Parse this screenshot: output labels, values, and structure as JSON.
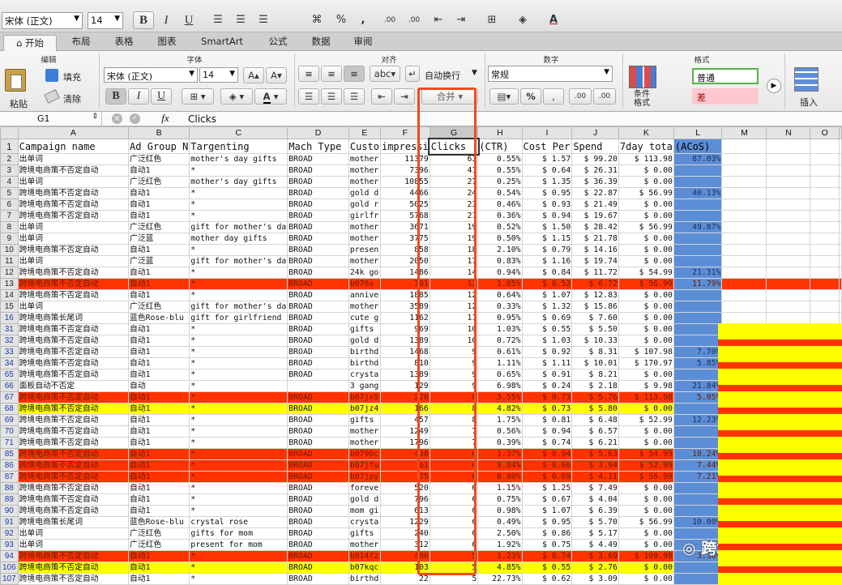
{
  "toolbar": {
    "font": "宋体 (正文)",
    "size": "14",
    "bold": "B",
    "italic": "I",
    "underline": "U",
    "percent": "%",
    "comma": ",",
    "dec_inc": ".00",
    "dec_dec": ".00"
  },
  "tabs": [
    "开始",
    "布局",
    "表格",
    "图表",
    "SmartArt",
    "公式",
    "数据",
    "审阅"
  ],
  "ribbon": {
    "groups": {
      "edit": "编辑",
      "font": "字体",
      "align": "对齐",
      "number": "数字",
      "format": "格式"
    },
    "paste": "粘贴",
    "fill": "填充",
    "clear": "清除",
    "font": "宋体 (正文)",
    "size": "14",
    "wrap": "自动换行",
    "merge": "合并",
    "numfmt": "常规",
    "cond_format": "条件\n格式",
    "style_normal": "普通",
    "style_bad": "差",
    "insert": "插入"
  },
  "formula": {
    "cell": "G1",
    "fx": "fx",
    "value": "Clicks"
  },
  "columns": [
    "A",
    "B",
    "C",
    "D",
    "E",
    "F",
    "G",
    "H",
    "I",
    "J",
    "K",
    "L",
    "M",
    "N",
    "O"
  ],
  "headers": [
    "Campaign name",
    "Ad Group N",
    "Targenting",
    "Mach Type",
    "Custo",
    "impressi",
    "Clicks",
    "(CTR)",
    "Cost Per",
    "Spend",
    "7day tota",
    "(ACoS)"
  ],
  "rows": [
    {
      "r": "2",
      "s": "",
      "c": [
        "出单词",
        "广泛红色",
        "mother's day gifts",
        "BROAD",
        "mother",
        "11379",
        "63",
        "0.55%",
        "$ 1.57",
        "$ 99.20",
        "$ 113.98",
        "87.03%"
      ]
    },
    {
      "r": "3",
      "s": "",
      "c": [
        "跨境电商策不否定自动",
        "自动1",
        "*",
        "BROAD",
        "mother",
        "7396",
        "41",
        "0.55%",
        "$ 0.64",
        "$ 26.31",
        "$ 0.00",
        ""
      ]
    },
    {
      "r": "4",
      "s": "",
      "c": [
        "出单词",
        "广泛红色",
        "mother's day gifts",
        "BROAD",
        "mother",
        "10855",
        "27",
        "0.25%",
        "$ 1.35",
        "$ 36.39",
        "$ 0.00",
        ""
      ]
    },
    {
      "r": "5",
      "s": "",
      "c": [
        "跨境电商策不否定自动",
        "自动1",
        "*",
        "BROAD",
        "gold d",
        "4466",
        "24",
        "0.54%",
        "$ 0.95",
        "$ 22.87",
        "$ 56.99",
        "40.13%"
      ]
    },
    {
      "r": "6",
      "s": "",
      "c": [
        "跨境电商策不否定自动",
        "自动1",
        "*",
        "BROAD",
        "gold r",
        "5025",
        "23",
        "0.46%",
        "$ 0.93",
        "$ 21.49",
        "$ 0.00",
        ""
      ]
    },
    {
      "r": "7",
      "s": "",
      "c": [
        "跨境电商策不否定自动",
        "自动1",
        "*",
        "BROAD",
        "girlfr",
        "5768",
        "21",
        "0.36%",
        "$ 0.94",
        "$ 19.67",
        "$ 0.00",
        ""
      ]
    },
    {
      "r": "8",
      "s": "",
      "c": [
        "出单词",
        "广泛红色",
        "gift for mother's da",
        "BROAD",
        "mother",
        "3671",
        "19",
        "0.52%",
        "$ 1.50",
        "$ 28.42",
        "$ 56.99",
        "49.87%"
      ]
    },
    {
      "r": "9",
      "s": "",
      "c": [
        "出单词",
        "广泛蓝",
        "mother day gifts",
        "BROAD",
        "mother",
        "3775",
        "19",
        "0.50%",
        "$ 1.15",
        "$ 21.78",
        "$ 0.00",
        ""
      ]
    },
    {
      "r": "10",
      "s": "",
      "c": [
        "跨境电商策不否定自动",
        "自动1",
        "*",
        "BROAD",
        "presen",
        "858",
        "18",
        "2.10%",
        "$ 0.79",
        "$ 14.16",
        "$ 0.00",
        ""
      ]
    },
    {
      "r": "11",
      "s": "",
      "c": [
        "出单词",
        "广泛蓝",
        "gift for mother's da",
        "BROAD",
        "mother",
        "2050",
        "17",
        "0.83%",
        "$ 1.16",
        "$ 19.74",
        "$ 0.00",
        ""
      ]
    },
    {
      "r": "12",
      "s": "",
      "c": [
        "跨境电商策不否定自动",
        "自动1",
        "*",
        "BROAD",
        "24k go",
        "1486",
        "14",
        "0.94%",
        "$ 0.84",
        "$ 11.72",
        "$ 54.99",
        "21.31%"
      ]
    },
    {
      "r": "13",
      "s": "red",
      "c": [
        "跨境电商策不否定自动",
        "自动1",
        "*",
        "BROAD",
        "b076x",
        "701",
        "13",
        "1.85%",
        "$ 0.52",
        "$ 6.72",
        "$ 56.99",
        "11.79%"
      ]
    },
    {
      "r": "14",
      "s": "",
      "c": [
        "跨境电商策不否定自动",
        "自动1",
        "*",
        "BROAD",
        "annive",
        "1885",
        "12",
        "0.64%",
        "$ 1.07",
        "$ 12.83",
        "$ 0.00",
        ""
      ]
    },
    {
      "r": "15",
      "s": "",
      "c": [
        "出单词",
        "广泛红色",
        "gift for mother's da",
        "BROAD",
        "mother",
        "3589",
        "12",
        "0.33%",
        "$ 1.32",
        "$ 15.86",
        "$ 0.00",
        ""
      ]
    },
    {
      "r": "16",
      "s": "",
      "c": [
        "跨境电商策长尾词",
        "蓝色Rose-blu",
        "gift for girlfriend",
        "BROAD",
        "cute g",
        "1162",
        "11",
        "0.95%",
        "$ 0.69",
        "$ 7.60",
        "$ 0.00",
        ""
      ]
    },
    {
      "r": "31",
      "s": "",
      "c": [
        "跨境电商策不否定自动",
        "自动1",
        "*",
        "BROAD",
        "gifts",
        "969",
        "10",
        "1.03%",
        "$ 0.55",
        "$ 5.50",
        "$ 0.00",
        ""
      ]
    },
    {
      "r": "32",
      "s": "",
      "c": [
        "跨境电商策不否定自动",
        "自动1",
        "*",
        "BROAD",
        "gold d",
        "1389",
        "10",
        "0.72%",
        "$ 1.03",
        "$ 10.33",
        "$ 0.00",
        ""
      ]
    },
    {
      "r": "33",
      "s": "",
      "c": [
        "跨境电商策不否定自动",
        "自动1",
        "*",
        "BROAD",
        "birthd",
        "1468",
        "9",
        "0.61%",
        "$ 0.92",
        "$ 8.31",
        "$ 107.98",
        "7.70%"
      ]
    },
    {
      "r": "34",
      "s": "",
      "c": [
        "跨境电商策不否定自动",
        "自动1",
        "*",
        "BROAD",
        "birthd",
        "810",
        "9",
        "1.11%",
        "$ 1.11",
        "$ 10.01",
        "$ 170.97",
        "5.85%"
      ]
    },
    {
      "r": "65",
      "s": "",
      "c": [
        "跨境电商策不否定自动",
        "自动1",
        "*",
        "BROAD",
        "crysta",
        "1389",
        "9",
        "0.65%",
        "$ 0.91",
        "$ 8.21",
        "$ 0.00",
        ""
      ]
    },
    {
      "r": "66",
      "s": "",
      "c": [
        "面板自动不否定",
        "自动",
        "*",
        "",
        "3 gang",
        "129",
        "9",
        "6.98%",
        "$ 0.24",
        "$ 2.18",
        "$ 9.98",
        "21.84%"
      ]
    },
    {
      "r": "67",
      "s": "red",
      "c": [
        "跨境电商策不否定自动",
        "自动1",
        "*",
        "BROAD",
        "b07jx9",
        "226",
        "8",
        "3.55%",
        "$ 0.73",
        "$ 5.76",
        "$ 113.98",
        "5.05%"
      ]
    },
    {
      "r": "68",
      "s": "yel",
      "c": [
        "跨境电商策不否定自动",
        "自动1",
        "*",
        "BROAD",
        "b07jz4",
        "166",
        "8",
        "4.82%",
        "$ 0.73",
        "$ 5.80",
        "$ 0.00",
        ""
      ]
    },
    {
      "r": "69",
      "s": "",
      "c": [
        "跨境电商策不否定自动",
        "自动1",
        "*",
        "BROAD",
        "gifts",
        "457",
        "8",
        "1.75%",
        "$ 0.81",
        "$ 6.48",
        "$ 52.99",
        "12.23%"
      ]
    },
    {
      "r": "70",
      "s": "",
      "c": [
        "跨境电商策不否定自动",
        "自动1",
        "*",
        "BROAD",
        "mother",
        "1249",
        "7",
        "0.56%",
        "$ 0.94",
        "$ 6.57",
        "$ 0.00",
        ""
      ]
    },
    {
      "r": "71",
      "s": "",
      "c": [
        "跨境电商策不否定自动",
        "自动1",
        "*",
        "BROAD",
        "mother",
        "1796",
        "7",
        "0.39%",
        "$ 0.74",
        "$ 6.21",
        "$ 0.00",
        ""
      ]
    },
    {
      "r": "85",
      "s": "red",
      "c": [
        "跨境电商策不否定自动",
        "自动1",
        "*",
        "BROAD",
        "b079bc",
        "438",
        "6",
        "1.37%",
        "$ 0.94",
        "$ 5.63",
        "$ 54.99",
        "10.24%"
      ]
    },
    {
      "r": "86",
      "s": "red",
      "c": [
        "跨境电商策不否定自动",
        "自动1",
        "*",
        "BROAD",
        "b07jfu",
        "61",
        "6",
        "9.84%",
        "$ 0.66",
        "$ 3.94",
        "$ 52.99",
        "7.44%"
      ]
    },
    {
      "r": "87",
      "s": "red",
      "c": [
        "跨境电商策不否定自动",
        "自动1",
        "*",
        "BROAD",
        "b07jpy",
        "75",
        "6",
        "8.00%",
        "$ 0.69",
        "$ 4.11",
        "$ 56.99",
        "7.21%"
      ]
    },
    {
      "r": "88",
      "s": "",
      "c": [
        "跨境电商策不否定自动",
        "自动1",
        "*",
        "BROAD",
        "foreve",
        "520",
        "6",
        "1.15%",
        "$ 1.25",
        "$ 7.49",
        "$ 0.00",
        ""
      ]
    },
    {
      "r": "89",
      "s": "",
      "c": [
        "跨境电商策不否定自动",
        "自动1",
        "*",
        "BROAD",
        "gold d",
        "796",
        "6",
        "0.75%",
        "$ 0.67",
        "$ 4.04",
        "$ 0.00",
        ""
      ]
    },
    {
      "r": "90",
      "s": "",
      "c": [
        "跨境电商策不否定自动",
        "自动1",
        "*",
        "BROAD",
        "mom gi",
        "613",
        "6",
        "0.98%",
        "$ 1.07",
        "$ 6.39",
        "$ 0.00",
        ""
      ]
    },
    {
      "r": "91",
      "s": "",
      "c": [
        "跨境电商策长尾词",
        "蓝色Rose-blu",
        "crystal rose",
        "BROAD",
        "crysta",
        "1229",
        "6",
        "0.49%",
        "$ 0.95",
        "$ 5.70",
        "$ 56.99",
        "10.00%"
      ]
    },
    {
      "r": "92",
      "s": "",
      "c": [
        "出单词",
        "广泛红色",
        "gifts for mom",
        "BROAD",
        "gifts",
        "240",
        "6",
        "2.50%",
        "$ 0.86",
        "$ 5.17",
        "$ 0.00",
        ""
      ]
    },
    {
      "r": "93",
      "s": "",
      "c": [
        "出单词",
        "广泛红色",
        "present for mom",
        "BROAD",
        "mother",
        "312",
        "6",
        "1.92%",
        "$ 0.75",
        "$ 4.49",
        "$ 0.00",
        ""
      ]
    },
    {
      "r": "94",
      "s": "red",
      "c": [
        "跨境电商策不否定自动",
        "自动1",
        "*",
        "BROAD",
        "b014fz",
        "406",
        "5",
        "1.23%",
        "$ 0.74",
        "$ 3.69",
        "$ 109.98",
        "3.36%"
      ]
    },
    {
      "r": "106",
      "s": "yel",
      "c": [
        "跨境电商策不否定自动",
        "自动1",
        "*",
        "BROAD",
        "b07kqc",
        "103",
        "5",
        "4.85%",
        "$ 0.55",
        "$ 2.76",
        "$ 0.00",
        ""
      ]
    },
    {
      "r": "107",
      "s": "",
      "c": [
        "跨境电商策不否定自动",
        "自动1",
        "*",
        "BROAD",
        "birthd",
        "22",
        "5",
        "22.73%",
        "$ 0.62",
        "$ 3.09",
        "$ 0.00",
        ""
      ]
    }
  ],
  "watermark": "跨境电商策",
  "colors": {
    "red": "#ff3300",
    "yellow": "#ffff00",
    "acos_blue": "#5b8ed6",
    "highlight_box": "#f04a1e",
    "selected_tab": "#f6f6f6"
  }
}
